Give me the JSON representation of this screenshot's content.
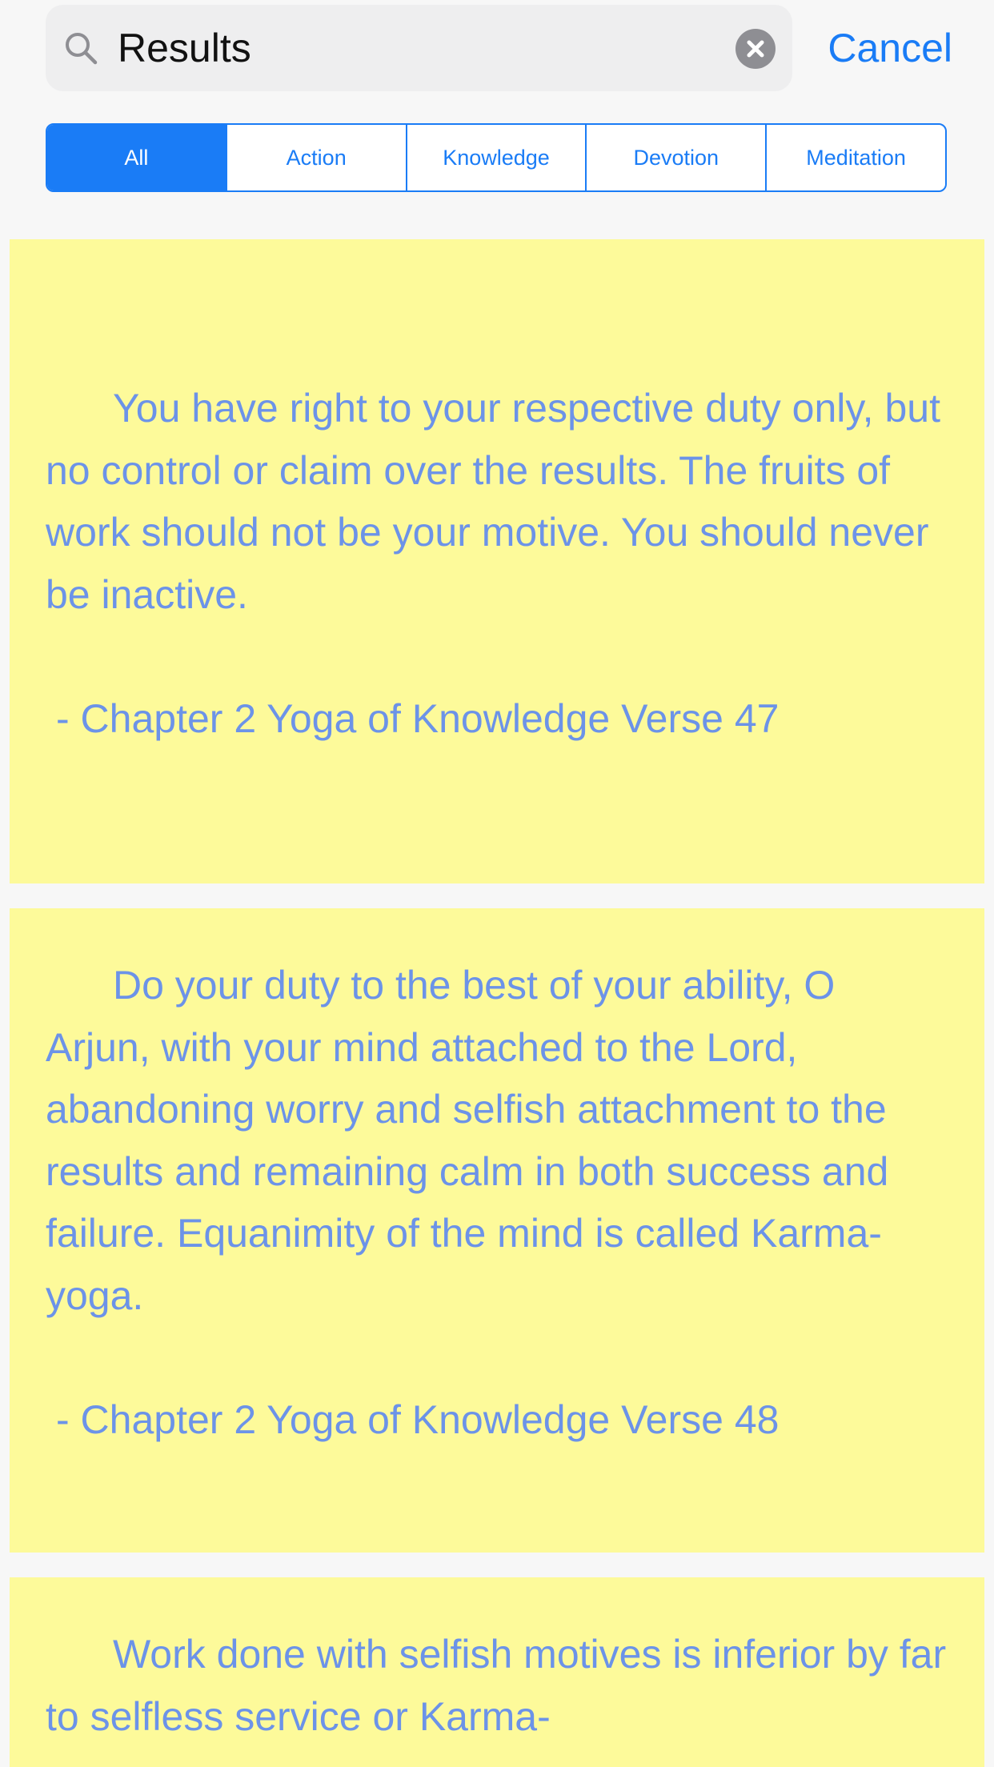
{
  "search": {
    "value": "Results",
    "cancel_label": "Cancel"
  },
  "icons": {
    "search": "search-icon",
    "clear": "clear-icon"
  },
  "segments": [
    {
      "label": "All",
      "selected": true
    },
    {
      "label": "Action",
      "selected": false
    },
    {
      "label": "Knowledge",
      "selected": false
    },
    {
      "label": "Devotion",
      "selected": false
    },
    {
      "label": "Meditation",
      "selected": false
    }
  ],
  "colors": {
    "accent": "#1a7cf6",
    "card_background": "#fdfa9a",
    "quote_text": "#6c93e8"
  },
  "results": [
    {
      "text": "You have right to your respective duty only, but no control or claim over the results. The fruits of work should not be your motive. You should never be inactive.",
      "reference": "- Chapter 2 Yoga of Knowledge  Verse 47"
    },
    {
      "text": "Do your duty to the best of your ability, O Arjun, with your mind attached to the Lord, abandoning worry and selfish attachment to the results and remaining calm in both success and failure. Equanimity of the mind is called Karma-yoga.",
      "reference": "- Chapter 2 Yoga of Knowledge  Verse 48"
    },
    {
      "text": "Work done with selfish motives is inferior by far to selfless service or Karma-",
      "reference": ""
    }
  ]
}
